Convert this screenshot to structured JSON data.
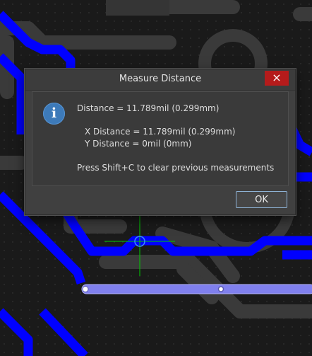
{
  "dialog": {
    "title": "Measure Distance",
    "close_glyph": "×",
    "icon": "info-icon",
    "info_glyph": "i",
    "distance_line": "Distance = 11.789mil (0.299mm)",
    "x_distance_line": "X Distance = 11.789mil (0.299mm)",
    "y_distance_line": "Y Distance = 0mil (0mm)",
    "hint_line": "Press Shift+C to clear previous measurements",
    "ok_label": "OK"
  },
  "colors": {
    "trace_blue": "#0000ff",
    "selected_trace": "#8080ee",
    "crosshair_green": "#00cc00",
    "cursor_blue": "#3b8cff",
    "close_red": "#b51b1b"
  }
}
